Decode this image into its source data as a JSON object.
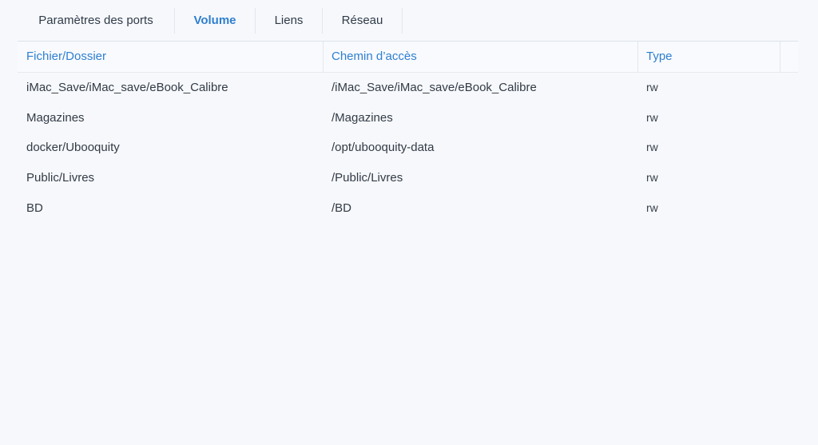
{
  "tabs": [
    {
      "label": "Paramètres des ports",
      "active": false
    },
    {
      "label": "Volume",
      "active": true
    },
    {
      "label": "Liens",
      "active": false
    },
    {
      "label": "Réseau",
      "active": false
    }
  ],
  "table": {
    "headers": [
      "Fichier/Dossier",
      "Chemin d’accès",
      "Type"
    ],
    "rows": [
      [
        "iMac_Save/iMac_save/eBook_Calibre",
        "/iMac_Save/iMac_save/eBook_Calibre",
        "rw"
      ],
      [
        "Magazines",
        "/Magazines",
        "rw"
      ],
      [
        "docker/Ubooquity",
        "/opt/ubooquity-data",
        "rw"
      ],
      [
        "Public/Livres",
        "/Public/Livres",
        "rw"
      ],
      [
        "BD",
        "/BD",
        "rw"
      ]
    ]
  },
  "colors": {
    "accent": "#2f7fd0",
    "text": "#333b45",
    "background": "#f6f8fc"
  }
}
